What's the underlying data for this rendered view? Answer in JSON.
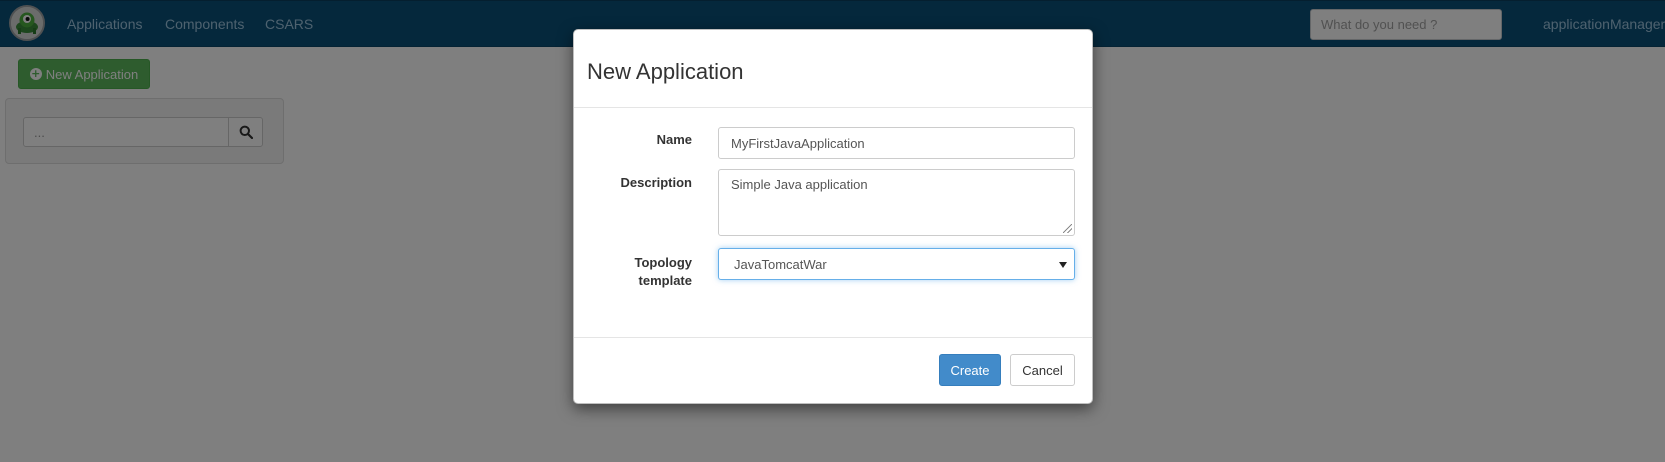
{
  "navbar": {
    "logo_icon": "alien-logo-icon",
    "links": [
      "Applications",
      "Components",
      "CSARS"
    ],
    "search_placeholder": "What do you need ?",
    "user_label": "applicationManager",
    "background_color": "#0b5079"
  },
  "toolbar": {
    "new_app_label": "New Application",
    "new_app_icon": "plus-circle-icon"
  },
  "search_panel": {
    "placeholder": "...",
    "search_icon": "search-icon"
  },
  "modal": {
    "title": "New Application",
    "fields": {
      "name": {
        "label": "Name",
        "value": "MyFirstJavaApplication"
      },
      "description": {
        "label": "Description",
        "value": "Simple Java application"
      },
      "topology": {
        "label_line1": "Topology",
        "label_line2": "template",
        "selected": "JavaTomcatWar"
      }
    },
    "buttons": {
      "create": "Create",
      "cancel": "Cancel"
    },
    "create_color": "#428bca"
  }
}
